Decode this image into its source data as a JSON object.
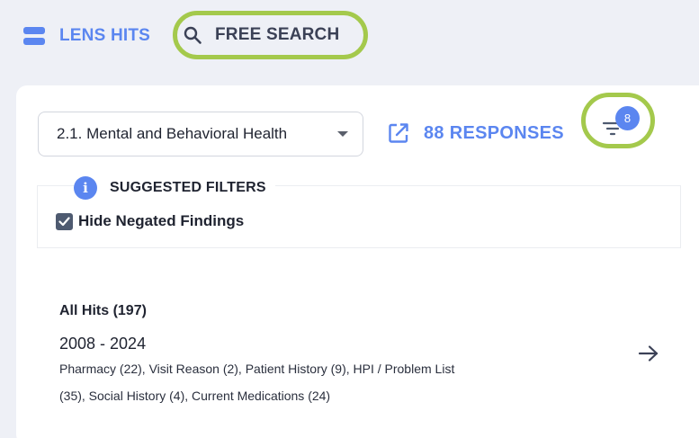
{
  "tabs": {
    "lens_hits": {
      "label": "LENS HITS",
      "icon": "lens-icon"
    },
    "free_search": {
      "label": "FREE SEARCH",
      "icon": "search-icon"
    }
  },
  "panel": {
    "section_select": {
      "value": "2.1. Mental and Behavioral Health"
    },
    "responses_link": {
      "label": "88 RESPONSES",
      "icon": "external-link-icon"
    },
    "filter_button": {
      "icon": "filter-icon",
      "badge": "8"
    }
  },
  "suggested_filters": {
    "title": "SUGGESTED FILTERS",
    "icon": "info-icon",
    "hide_negated": {
      "label": "Hide Negated Findings",
      "checked": true
    }
  },
  "hits": {
    "title": "All Hits (197)",
    "years": "2008 - 2024",
    "categories_line1": "Pharmacy (22), Visit Reason (2), Patient History (9), HPI / Problem List",
    "categories_line2": "(35), Social History (4), Current Medications (24)"
  },
  "colors": {
    "accent": "#5b86f0",
    "highlight": "#a4c94c",
    "background": "#eef0f6",
    "card": "#ffffff",
    "checkbox": "#4e5a70"
  }
}
